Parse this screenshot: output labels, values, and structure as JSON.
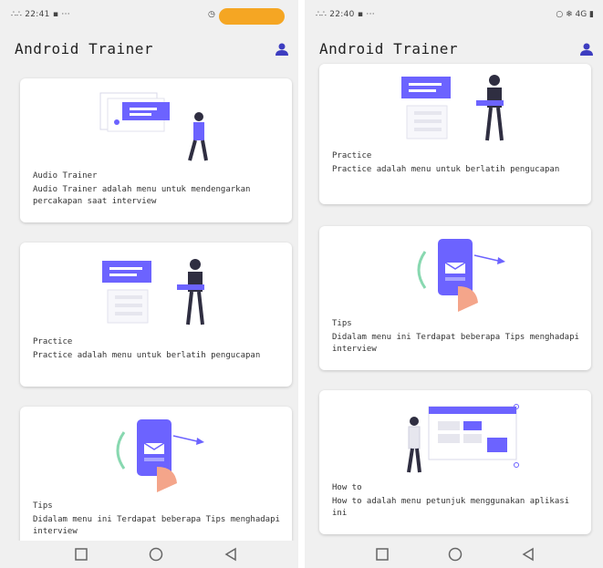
{
  "status": {
    "left_time": "22:41",
    "right_time": "22:40",
    "signal_text": "∴∴",
    "right_icons": "○ ❄ 4G ▮"
  },
  "app": {
    "title": "Android Trainer"
  },
  "left_cards": [
    {
      "title": "Audio Trainer",
      "desc": "Audio Trainer adalah menu untuk mendengarkan percakapan saat interview"
    },
    {
      "title": "Practice",
      "desc": "Practice adalah menu untuk berlatih pengucapan"
    },
    {
      "title": "Tips",
      "desc": "Didalam menu ini Terdapat beberapa Tips menghadapi interview"
    }
  ],
  "right_cards": [
    {
      "title": "Practice",
      "desc": "Practice adalah menu untuk berlatih pengucapan"
    },
    {
      "title": "Tips",
      "desc": "Didalam menu ini Terdapat beberapa Tips menghadapi interview"
    },
    {
      "title": "How to",
      "desc": "How to adalah menu petunjuk menggunakan aplikasi ini"
    }
  ],
  "colors": {
    "accent": "#6c63ff",
    "bg": "#f0f0f0",
    "card": "#ffffff",
    "orange": "#f5a623"
  },
  "icons": {
    "profile": "person-icon",
    "nav_square": "square-icon",
    "nav_circle": "circle-icon",
    "nav_back": "triangle-back-icon"
  }
}
